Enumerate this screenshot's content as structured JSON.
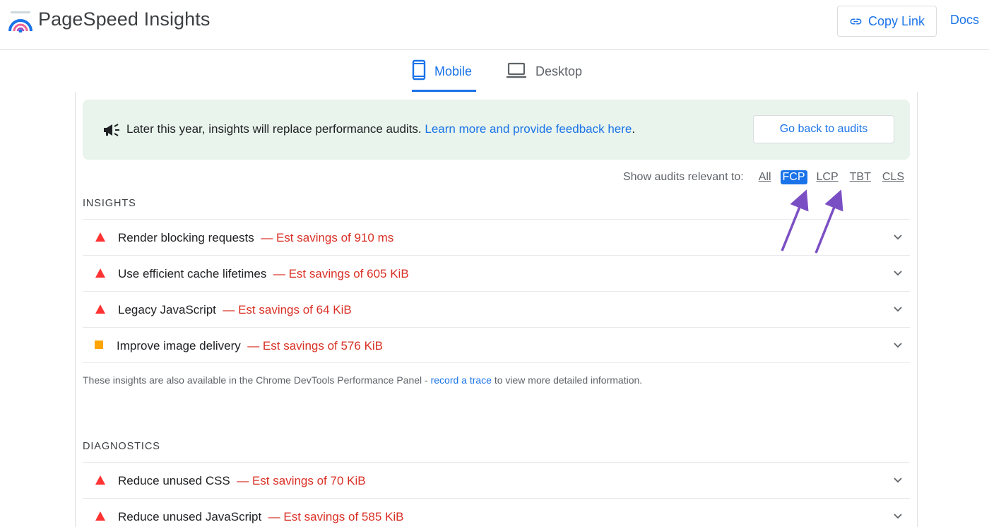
{
  "header": {
    "app_title": "PageSpeed Insights",
    "copy_link_label": "Copy Link",
    "docs_label": "Docs"
  },
  "tabs": [
    {
      "label": "Mobile",
      "active": true,
      "icon": "phone-icon"
    },
    {
      "label": "Desktop",
      "active": false,
      "icon": "laptop-icon"
    }
  ],
  "banner": {
    "text": "Later this year, insights will replace performance audits.",
    "link_text": "Learn more and provide feedback here",
    "after_link": ".",
    "button_label": "Go back to audits"
  },
  "filter": {
    "label": "Show audits relevant to:",
    "options": [
      "All",
      "FCP",
      "LCP",
      "TBT",
      "CLS"
    ],
    "selected": "FCP"
  },
  "insights": {
    "title": "INSIGHTS",
    "items": [
      {
        "title": "Render blocking requests",
        "savings": "— Est savings of 910 ms",
        "severity": "fail"
      },
      {
        "title": "Use efficient cache lifetimes",
        "savings": "— Est savings of 605 KiB",
        "severity": "fail"
      },
      {
        "title": "Legacy JavaScript",
        "savings": "— Est savings of 64 KiB",
        "severity": "fail"
      },
      {
        "title": "Improve image delivery",
        "savings": "— Est savings of 576 KiB",
        "severity": "average"
      }
    ],
    "note_before": "These insights are also available in the Chrome DevTools Performance Panel - ",
    "note_link": "record a trace",
    "note_after": " to view more detailed information."
  },
  "diagnostics": {
    "title": "DIAGNOSTICS",
    "items": [
      {
        "title": "Reduce unused CSS",
        "savings": "— Est savings of 70 KiB",
        "severity": "fail"
      },
      {
        "title": "Reduce unused JavaScript",
        "savings": "— Est savings of 585 KiB",
        "severity": "fail"
      }
    ]
  },
  "colors": {
    "accent": "#1a73e8",
    "fail": "#f33",
    "average": "#ffa400",
    "savings": "#d93025",
    "banner_bg": "#e8f4ec",
    "annotation_arrow": "#7b4fc4"
  }
}
